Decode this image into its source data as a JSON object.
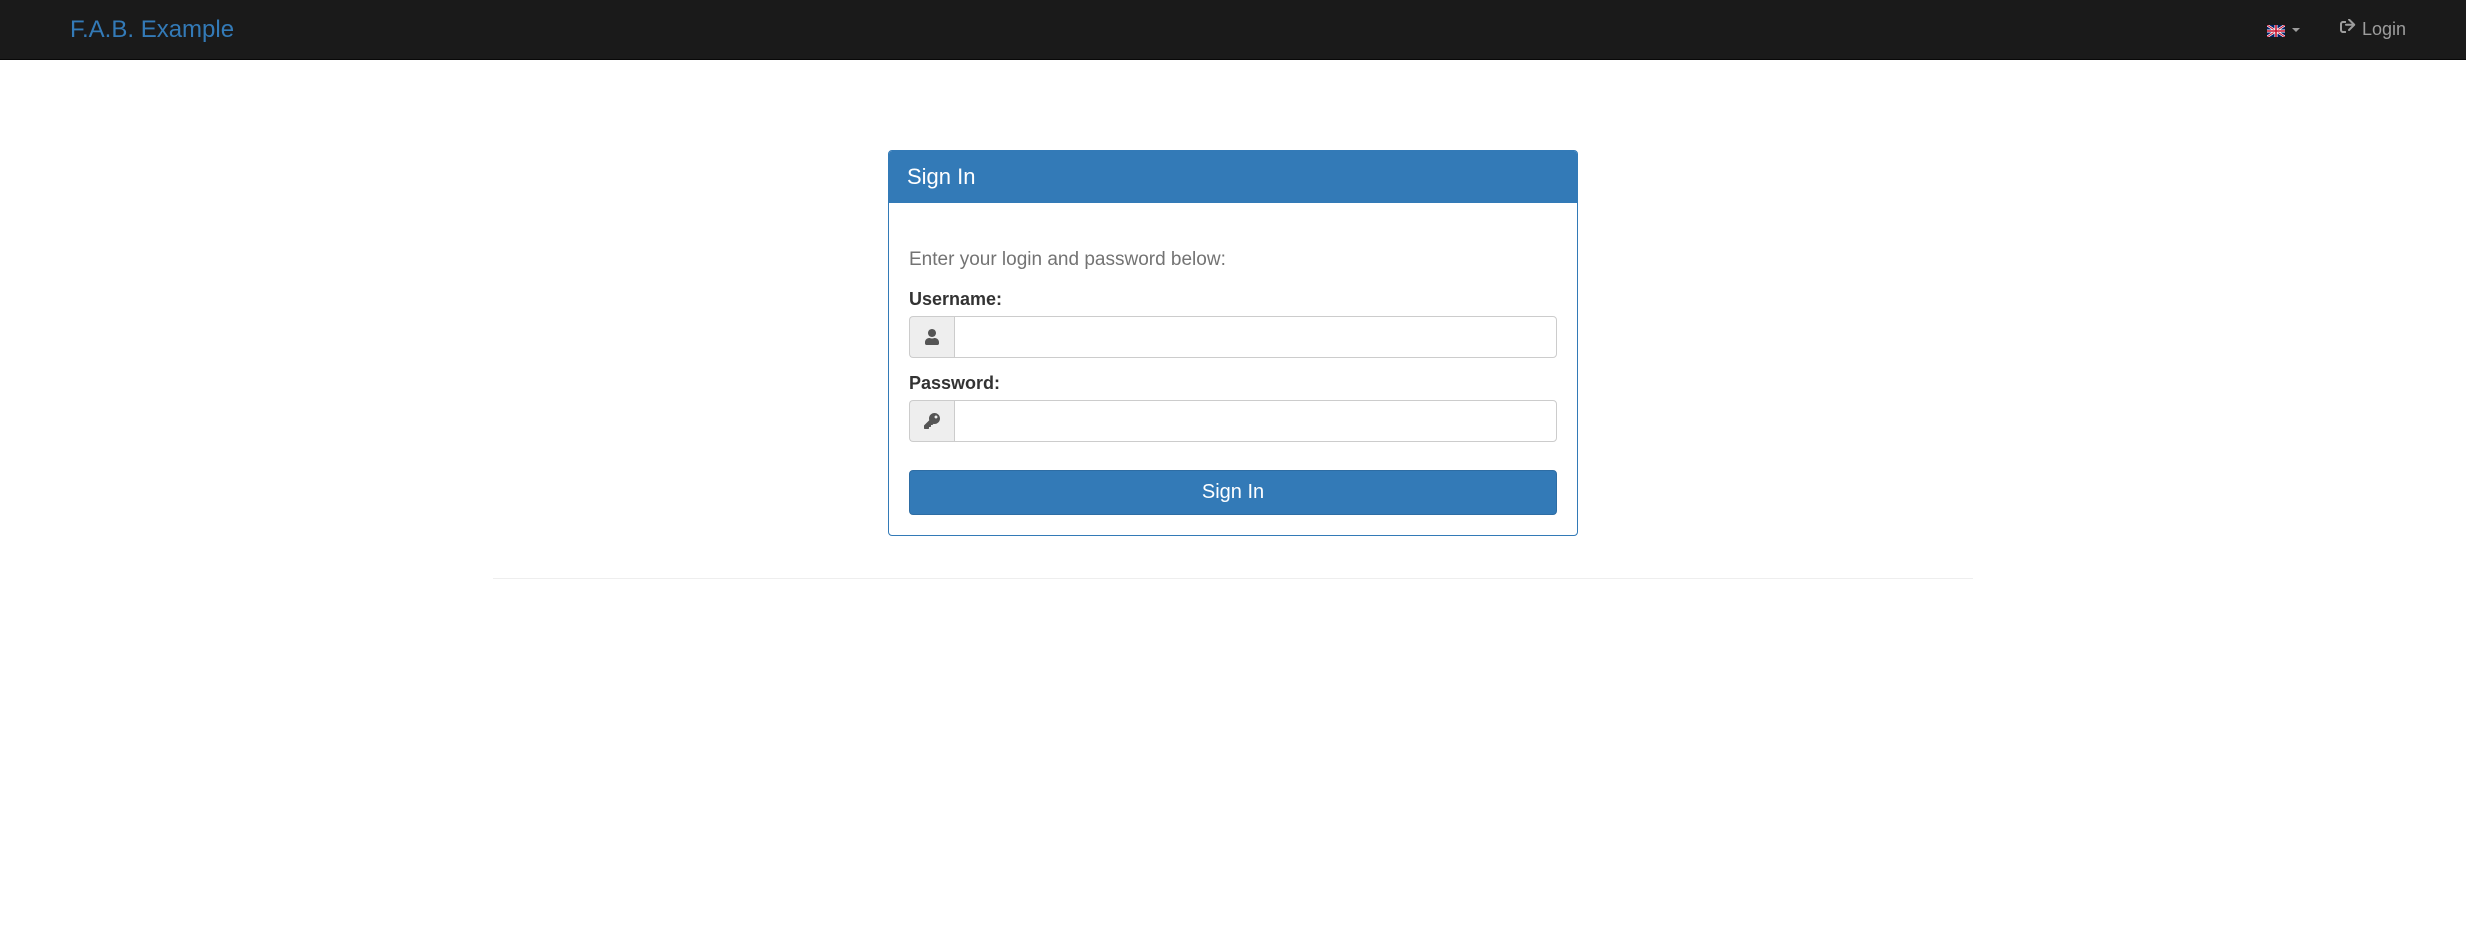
{
  "navbar": {
    "brand": "F.A.B. Example",
    "login_label": "Login"
  },
  "panel": {
    "title": "Sign In",
    "help_text": "Enter your login and password below:",
    "username_label": "Username:",
    "password_label": "Password:",
    "submit_label": "Sign In"
  }
}
